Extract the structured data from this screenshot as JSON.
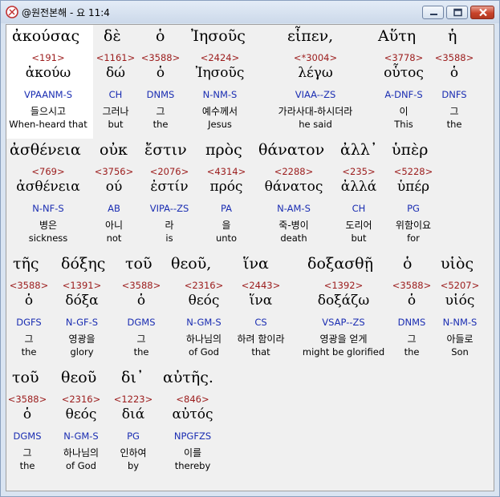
{
  "window": {
    "title": "@원전본해 - 요 11:4"
  },
  "lines": [
    {
      "words": [
        {
          "greek": "ἀκούσας",
          "strong": "<191>",
          "lemma": "ἀκούω",
          "parse": "VPAANM-S",
          "korean": "들으시고",
          "english": "When-heard that",
          "selected": true
        },
        {
          "greek": "δὲ",
          "strong": "<1161>",
          "lemma": "δώ",
          "parse": "CH",
          "korean": "그러나",
          "english": "but"
        },
        {
          "greek": "ὁ",
          "strong": "<3588>",
          "lemma": "ὁ",
          "parse": "DNMS",
          "korean": "그",
          "english": "the"
        },
        {
          "greek": "Ἰησοῦς",
          "strong": "<2424>",
          "lemma": "Ἰησοῦς",
          "parse": "N-NM-S",
          "korean": "예수께서",
          "english": "Jesus"
        },
        {
          "greek": "εἶπεν,",
          "strong": "<*3004>",
          "lemma": "λέγω",
          "parse": "VIAA--ZS",
          "korean": "가라사대-하시더라",
          "english": "he said"
        },
        {
          "greek": "Αὕτη",
          "strong": "<3778>",
          "lemma": "οὗτος",
          "parse": "A-DNF-S",
          "korean": "이",
          "english": "This"
        },
        {
          "greek": "ἡ",
          "strong": "<3588>",
          "lemma": "ὁ",
          "parse": "DNFS",
          "korean": "그",
          "english": "the"
        }
      ]
    },
    {
      "words": [
        {
          "greek": "ἀσθένεια",
          "strong": "<769>",
          "lemma": "ἀσθένεια",
          "parse": "N-NF-S",
          "korean": "병은",
          "english": "sickness"
        },
        {
          "greek": "οὐκ",
          "strong": "<3756>",
          "lemma": "ού",
          "parse": "AB",
          "korean": "아니",
          "english": "not"
        },
        {
          "greek": "ἔστιν",
          "strong": "<2076>",
          "lemma": "ἐστίν",
          "parse": "VIPA--ZS",
          "korean": "라",
          "english": "is"
        },
        {
          "greek": "πρὸς",
          "strong": "<4314>",
          "lemma": "πρός",
          "parse": "PA",
          "korean": "을",
          "english": "unto"
        },
        {
          "greek": "θάνατον",
          "strong": "<2288>",
          "lemma": "θάνατος",
          "parse": "N-AM-S",
          "korean": "죽-병이",
          "english": "death"
        },
        {
          "greek": "ἀλλ᾽",
          "strong": "<235>",
          "lemma": "ἀλλά",
          "parse": "CH",
          "korean": "도리어",
          "english": "but"
        },
        {
          "greek": "ὑπὲρ",
          "strong": "<5228>",
          "lemma": "ὑπέρ",
          "parse": "PG",
          "korean": "위함이요",
          "english": "for"
        }
      ]
    },
    {
      "words": [
        {
          "greek": "τῆς",
          "strong": "<3588>",
          "lemma": "ὁ",
          "parse": "DGFS",
          "korean": "그",
          "english": "the"
        },
        {
          "greek": "δόξης",
          "strong": "<1391>",
          "lemma": "δόξα",
          "parse": "N-GF-S",
          "korean": "영광을",
          "english": "glory"
        },
        {
          "greek": "τοῦ",
          "strong": "<3588>",
          "lemma": "ὁ",
          "parse": "DGMS",
          "korean": "그",
          "english": "the"
        },
        {
          "greek": "θεοῦ,",
          "strong": "<2316>",
          "lemma": "θεός",
          "parse": "N-GM-S",
          "korean": "하나님의",
          "english": "of God"
        },
        {
          "greek": "ἵνα",
          "strong": "<2443>",
          "lemma": "ἵνα",
          "parse": "CS",
          "korean": "하려 함이라",
          "english": "that"
        },
        {
          "greek": "δοξασθῇ",
          "strong": "<1392>",
          "lemma": "δοξάζω",
          "parse": "VSAP--ZS",
          "korean": "영광을 얻게",
          "english": "might be glorified"
        },
        {
          "greek": "ὁ",
          "strong": "<3588>",
          "lemma": "ὁ",
          "parse": "DNMS",
          "korean": "그",
          "english": "the"
        },
        {
          "greek": "υἱὸς",
          "strong": "<5207>",
          "lemma": "υἱός",
          "parse": "N-NM-S",
          "korean": "아들로",
          "english": "Son"
        }
      ]
    },
    {
      "words": [
        {
          "greek": "τοῦ",
          "strong": "<3588>",
          "lemma": "ὁ",
          "parse": "DGMS",
          "korean": "그",
          "english": "the"
        },
        {
          "greek": "θεοῦ",
          "strong": "<2316>",
          "lemma": "θεός",
          "parse": "N-GM-S",
          "korean": "하나님의",
          "english": "of God"
        },
        {
          "greek": "δι᾽",
          "strong": "<1223>",
          "lemma": "διά",
          "parse": "PG",
          "korean": "인하여",
          "english": "by"
        },
        {
          "greek": "αὐτῆς.",
          "strong": "<846>",
          "lemma": "αὐτός",
          "parse": "NPGFZS",
          "korean": "이를",
          "english": "thereby"
        }
      ]
    }
  ]
}
